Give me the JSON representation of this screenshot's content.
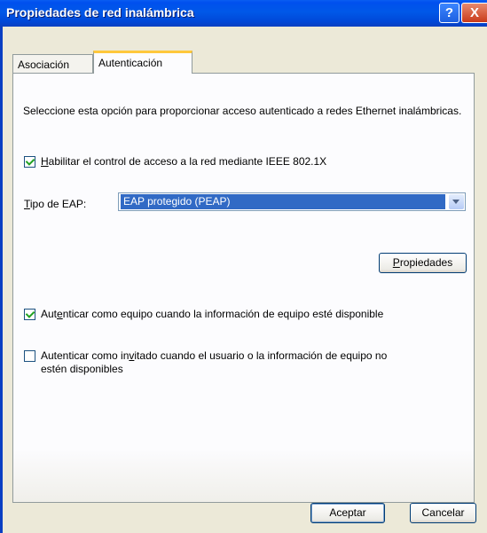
{
  "window": {
    "title": "Propiedades de red inalámbrica",
    "help_glyph": "?",
    "close_glyph": "X"
  },
  "tabs": [
    {
      "label": "Asociación",
      "active": false
    },
    {
      "label": "Autenticación",
      "active": true
    }
  ],
  "description": "Seleccione esta opción para proporcionar acceso autenticado a redes Ethernet inalámbricas.",
  "enable_8021x": {
    "label_access_key": "H",
    "label_rest": "abilitar el control de acceso a la red mediante IEEE 802.1X",
    "checked": true
  },
  "eap_type": {
    "label_access_key": "T",
    "label_rest": "ipo de EAP:",
    "selected": "EAP protegido (PEAP)"
  },
  "properties_button": {
    "access_key": "P",
    "rest": "ropiedades"
  },
  "auth_computer": {
    "label_pre": "Aut",
    "label_access_key": "e",
    "label_rest": "nticar como equipo cuando la información de equipo esté disponible",
    "checked": true
  },
  "auth_guest": {
    "label_pre": "Autenticar como in",
    "label_access_key": "v",
    "label_rest": "itado cuando el usuario o la información de equipo no",
    "label_line2": "estén disponibles",
    "checked": false
  },
  "footer": {
    "ok_label": "Aceptar",
    "cancel_label": "Cancelar"
  },
  "colors": {
    "titlebar": "#0054E3",
    "dialog_bg": "#ECE9D8",
    "tab_highlight": "#FFC83C",
    "selection": "#316AC5",
    "check": "#21A121"
  }
}
